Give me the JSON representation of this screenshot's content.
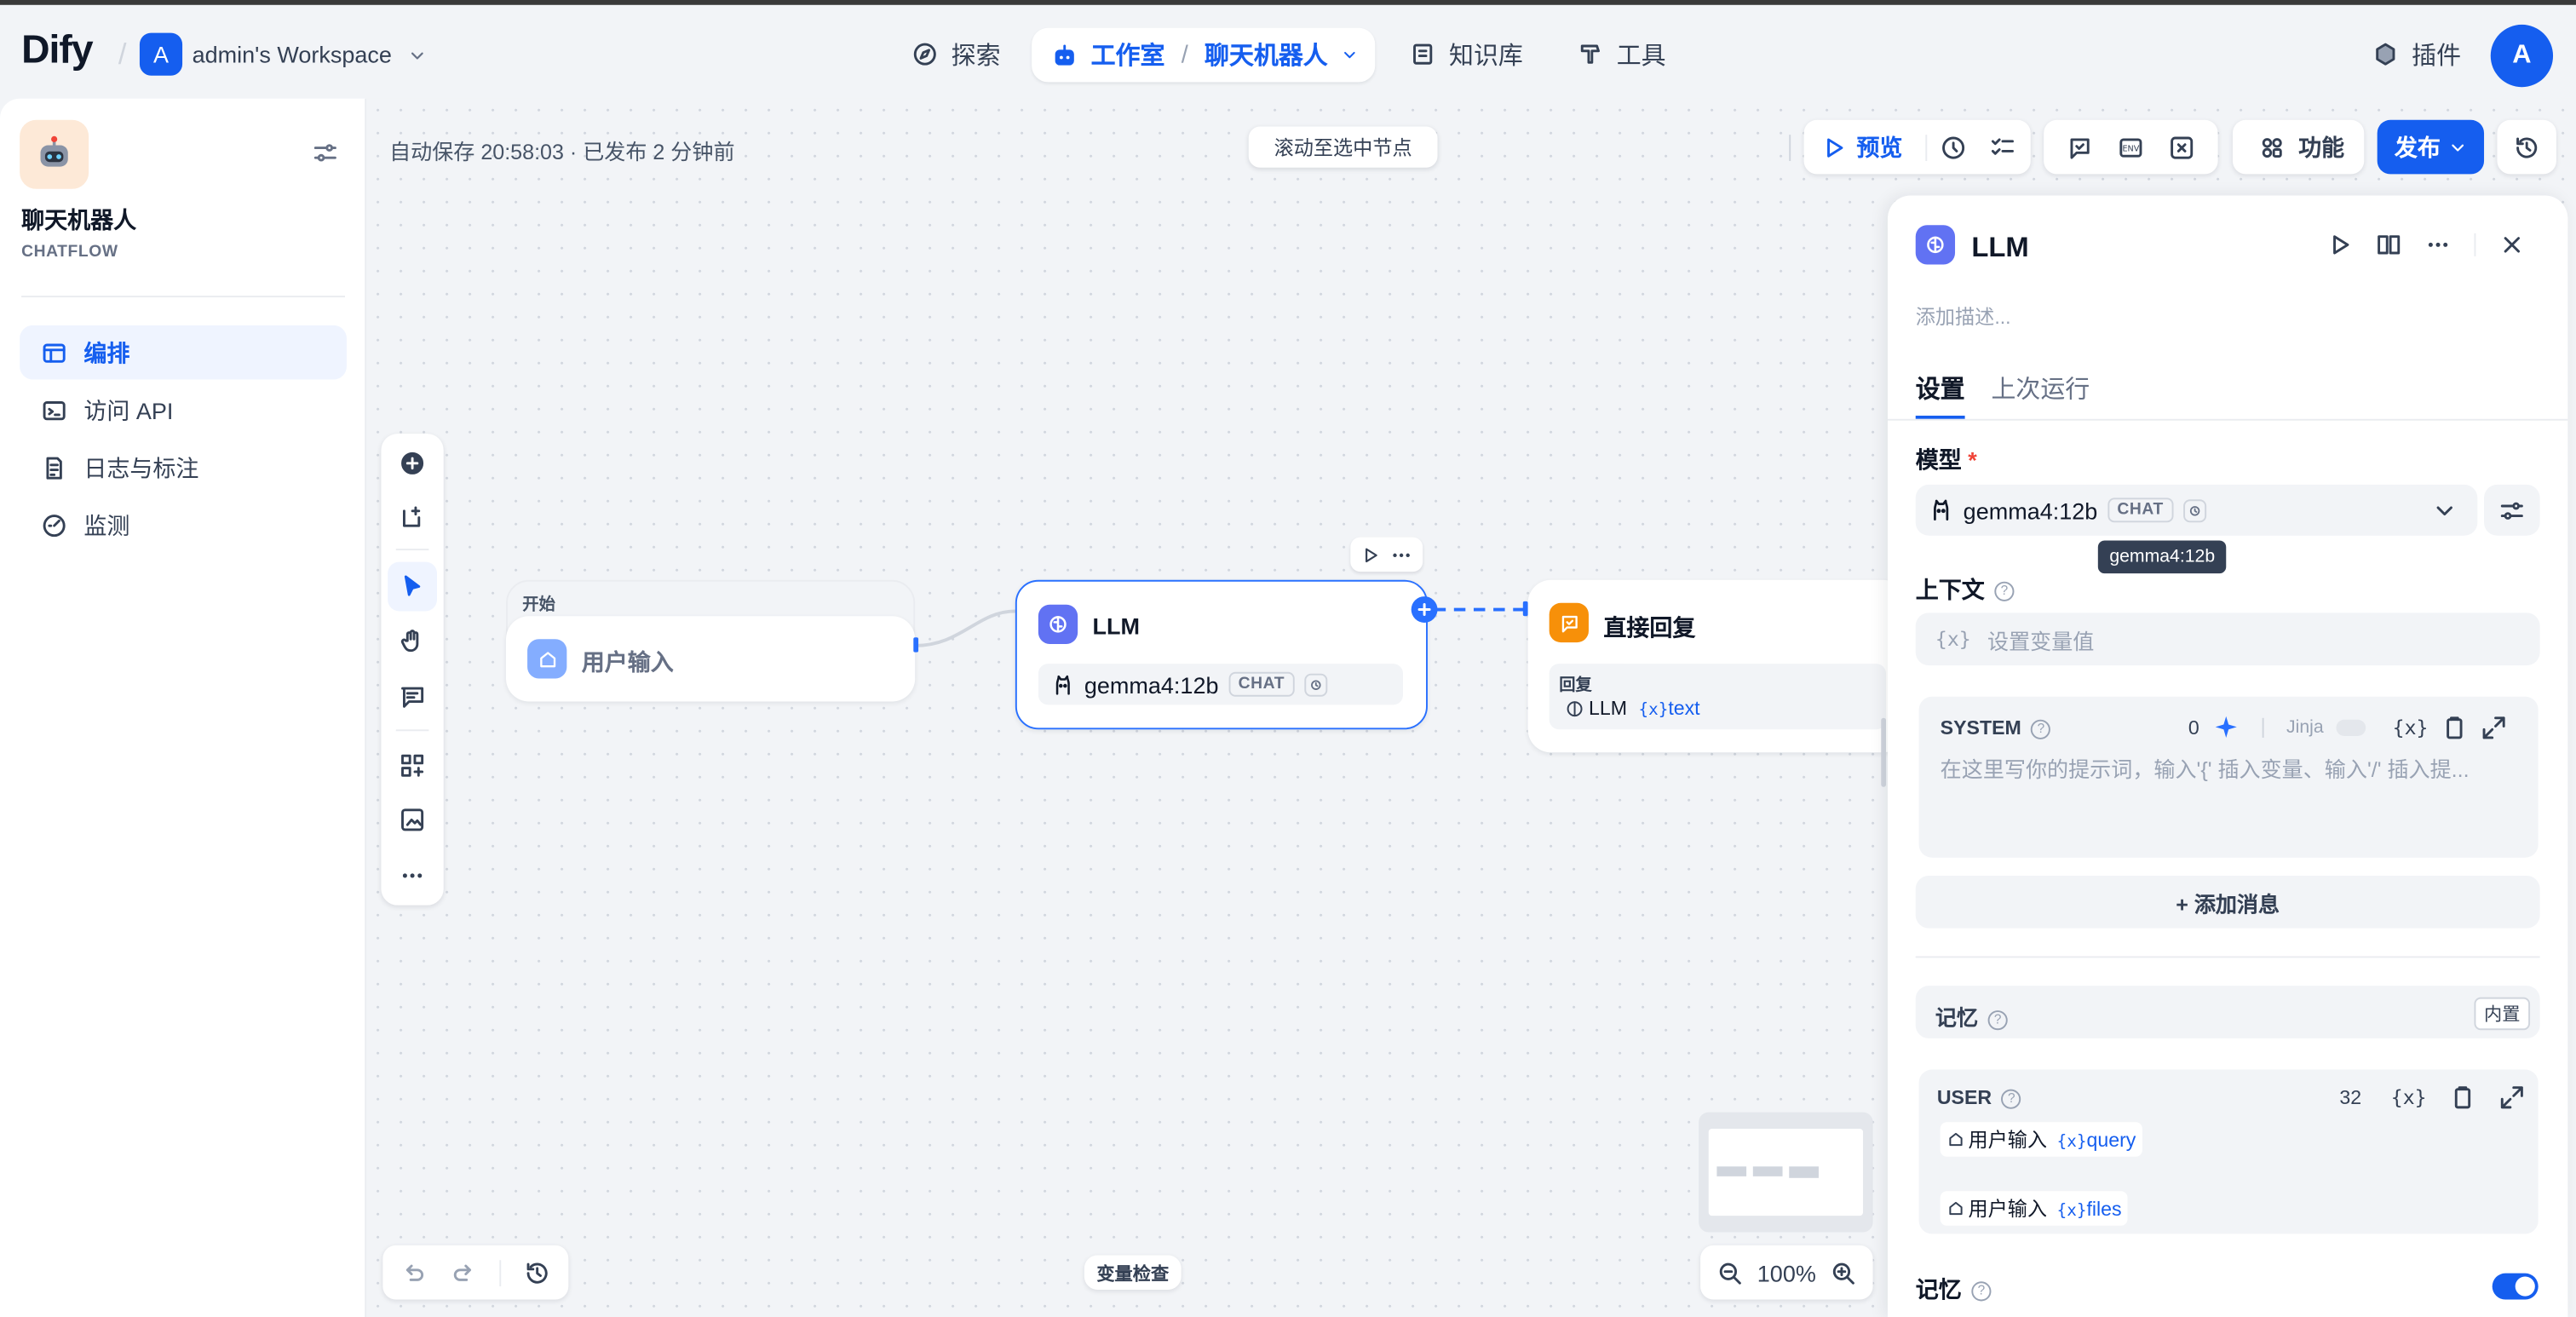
{
  "header": {
    "logo": "Dify",
    "workspace_initial": "A",
    "workspace_name": "admin's Workspace",
    "nav": {
      "explore": "探索",
      "studio": "工作室",
      "studio_app": "聊天机器人",
      "knowledge": "知识库",
      "tools": "工具",
      "plugins": "插件"
    },
    "user_initial": "A"
  },
  "sidebar": {
    "app_name": "聊天机器人",
    "app_type": "CHATFLOW",
    "items": [
      {
        "label": "编排",
        "icon": "layout-icon",
        "active": true
      },
      {
        "label": "访问 API",
        "icon": "terminal-icon"
      },
      {
        "label": "日志与标注",
        "icon": "file-list-icon"
      },
      {
        "label": "监测",
        "icon": "dashboard-icon"
      }
    ]
  },
  "canvas": {
    "autosave": "自动保存 20:58:03 · 已发布 2 分钟前",
    "scroll_to_node": "滚动至选中节点",
    "toolbar": {
      "preview": "预览",
      "features": "功能",
      "publish": "发布"
    },
    "nodes": {
      "start": {
        "group_label": "开始",
        "title": "用户输入"
      },
      "llm": {
        "title": "LLM",
        "model": "gemma4:12b",
        "model_tag": "CHAT"
      },
      "answer": {
        "title": "直接回复",
        "field_label": "回复",
        "var_node": "LLM",
        "var_name": "text"
      }
    },
    "var_inspect": "变量检查",
    "zoom": "100%"
  },
  "panel": {
    "title": "LLM",
    "desc_placeholder": "添加描述...",
    "tabs": [
      "设置",
      "上次运行"
    ],
    "model_label": "模型",
    "required_mark": "*",
    "model_name": "gemma4:12b",
    "model_tag": "CHAT",
    "tooltip": "gemma4:12b",
    "context_label": "上下文",
    "context_placeholder": "设置变量值",
    "system_label": "SYSTEM",
    "system_count": "0",
    "jinja": "Jinja",
    "system_placeholder": "在这里写你的提示词，输入'{' 插入变量、输入'/' 插入提...",
    "add_message": "+ 添加消息",
    "memory_label": "记忆",
    "memory_badge": "内置",
    "user_label": "USER",
    "user_count": "32",
    "user_vars": [
      {
        "node": "用户输入",
        "var": "query"
      },
      {
        "node": "用户输入",
        "var": "files"
      }
    ],
    "memory_toggle_label": "记忆"
  },
  "colors": {
    "accent": "#155eef",
    "llm_icon": "#6172f3",
    "answer_icon": "#f79009",
    "start_icon": "#84adff"
  }
}
